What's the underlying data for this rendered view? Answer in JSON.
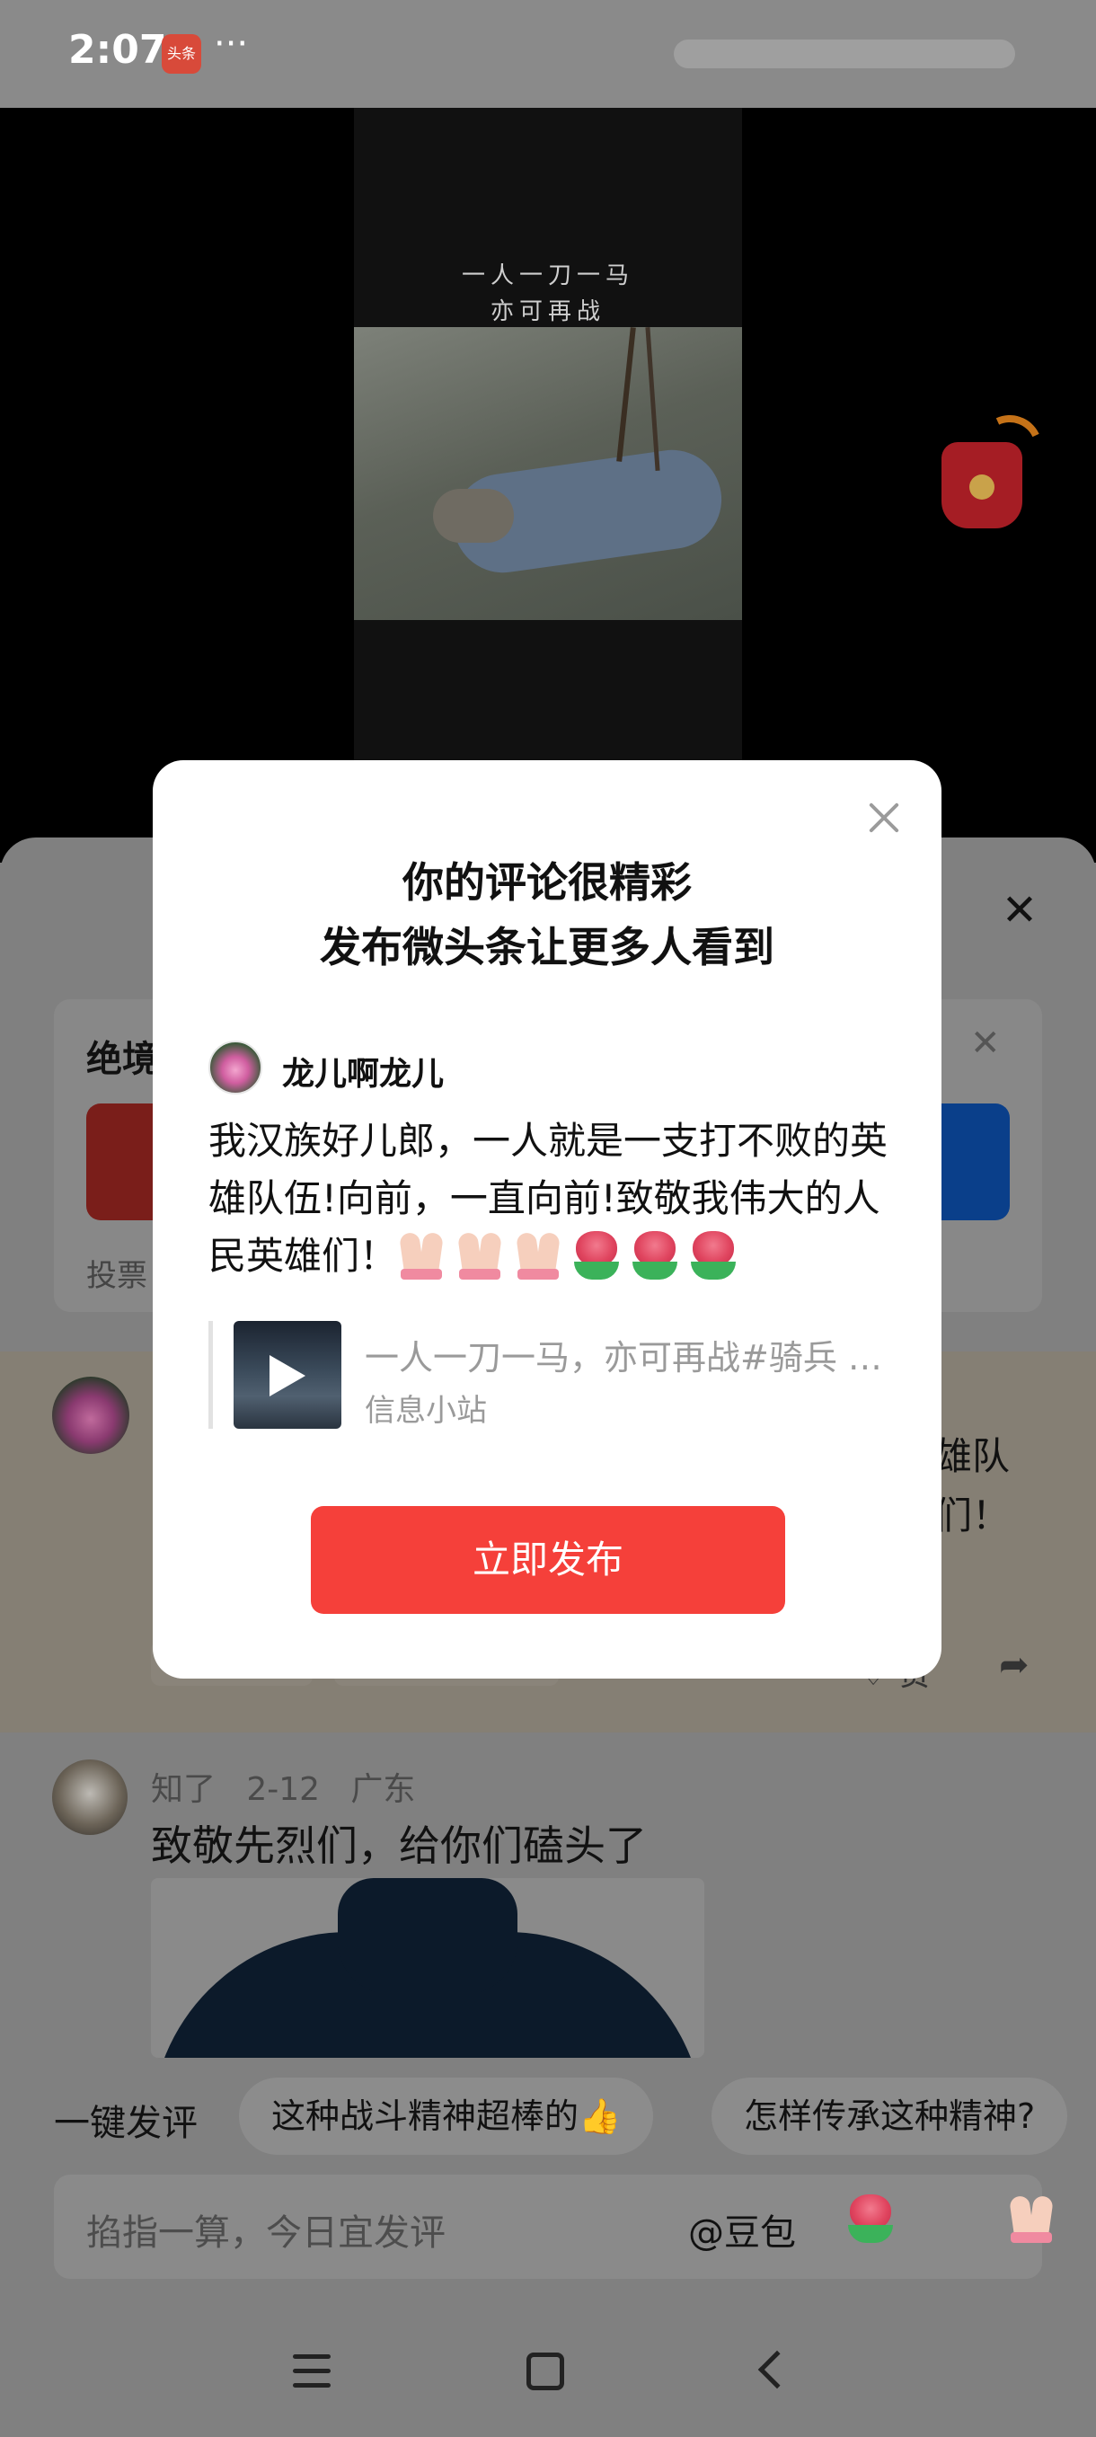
{
  "status_bar": {
    "time": "2:07",
    "app_badge": "头条",
    "more": "···"
  },
  "video": {
    "caption_line1": "一人一刀一马",
    "caption_line2": "亦可再战"
  },
  "poll": {
    "title": "绝境",
    "footer": "投票"
  },
  "comment1": {
    "text_line1": "雄队",
    "text_line2": "们！",
    "like_label": "赞"
  },
  "comment2": {
    "user": "知了",
    "date": "2-12",
    "location": "广东",
    "text": "致敬先烈们，给你们磕头了"
  },
  "quick_comments": {
    "label": "一键发评",
    "chips": [
      "这种战斗精神超棒的👍",
      "怎样传承这种精神?"
    ]
  },
  "input": {
    "placeholder": "掐指一算，今日宜发评",
    "mention": "@豆包",
    "emojis": [
      "rose-emoji",
      "pray-emoji"
    ]
  },
  "modal": {
    "title_line1": "你的评论很精彩",
    "title_line2": "发布微头条让更多人看到",
    "username": "龙儿啊龙儿",
    "comment": "我汉族好儿郎，一人就是一支打不败的英雄队伍!向前，一直向前!致敬我伟大的人民英雄们！",
    "emojis": [
      "pray",
      "pray",
      "pray",
      "rose",
      "rose",
      "rose"
    ],
    "quote_title": "一人一刀一马，亦可再战#骑兵 #抗日英雄",
    "quote_source": "信息小站",
    "publish_button": "立即发布"
  },
  "colors": {
    "accent": "#f5403a",
    "modal_bg": "#ffffff",
    "dim_overlay": "#7f7f7f"
  }
}
